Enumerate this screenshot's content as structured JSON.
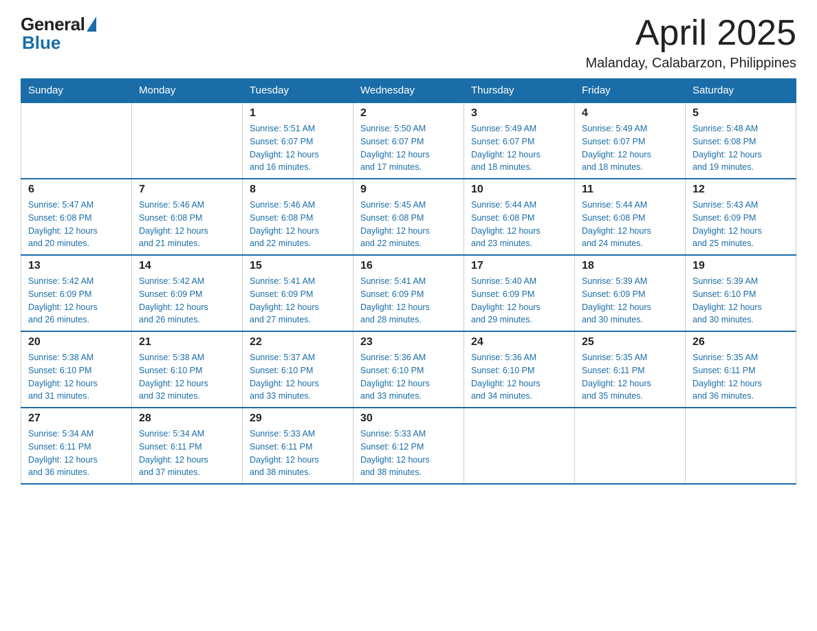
{
  "logo": {
    "general": "General",
    "blue": "Blue"
  },
  "header": {
    "month": "April 2025",
    "location": "Malanday, Calabarzon, Philippines"
  },
  "weekdays": [
    "Sunday",
    "Monday",
    "Tuesday",
    "Wednesday",
    "Thursday",
    "Friday",
    "Saturday"
  ],
  "weeks": [
    [
      {
        "day": "",
        "detail": ""
      },
      {
        "day": "",
        "detail": ""
      },
      {
        "day": "1",
        "detail": "Sunrise: 5:51 AM\nSunset: 6:07 PM\nDaylight: 12 hours\nand 16 minutes."
      },
      {
        "day": "2",
        "detail": "Sunrise: 5:50 AM\nSunset: 6:07 PM\nDaylight: 12 hours\nand 17 minutes."
      },
      {
        "day": "3",
        "detail": "Sunrise: 5:49 AM\nSunset: 6:07 PM\nDaylight: 12 hours\nand 18 minutes."
      },
      {
        "day": "4",
        "detail": "Sunrise: 5:49 AM\nSunset: 6:07 PM\nDaylight: 12 hours\nand 18 minutes."
      },
      {
        "day": "5",
        "detail": "Sunrise: 5:48 AM\nSunset: 6:08 PM\nDaylight: 12 hours\nand 19 minutes."
      }
    ],
    [
      {
        "day": "6",
        "detail": "Sunrise: 5:47 AM\nSunset: 6:08 PM\nDaylight: 12 hours\nand 20 minutes."
      },
      {
        "day": "7",
        "detail": "Sunrise: 5:46 AM\nSunset: 6:08 PM\nDaylight: 12 hours\nand 21 minutes."
      },
      {
        "day": "8",
        "detail": "Sunrise: 5:46 AM\nSunset: 6:08 PM\nDaylight: 12 hours\nand 22 minutes."
      },
      {
        "day": "9",
        "detail": "Sunrise: 5:45 AM\nSunset: 6:08 PM\nDaylight: 12 hours\nand 22 minutes."
      },
      {
        "day": "10",
        "detail": "Sunrise: 5:44 AM\nSunset: 6:08 PM\nDaylight: 12 hours\nand 23 minutes."
      },
      {
        "day": "11",
        "detail": "Sunrise: 5:44 AM\nSunset: 6:08 PM\nDaylight: 12 hours\nand 24 minutes."
      },
      {
        "day": "12",
        "detail": "Sunrise: 5:43 AM\nSunset: 6:09 PM\nDaylight: 12 hours\nand 25 minutes."
      }
    ],
    [
      {
        "day": "13",
        "detail": "Sunrise: 5:42 AM\nSunset: 6:09 PM\nDaylight: 12 hours\nand 26 minutes."
      },
      {
        "day": "14",
        "detail": "Sunrise: 5:42 AM\nSunset: 6:09 PM\nDaylight: 12 hours\nand 26 minutes."
      },
      {
        "day": "15",
        "detail": "Sunrise: 5:41 AM\nSunset: 6:09 PM\nDaylight: 12 hours\nand 27 minutes."
      },
      {
        "day": "16",
        "detail": "Sunrise: 5:41 AM\nSunset: 6:09 PM\nDaylight: 12 hours\nand 28 minutes."
      },
      {
        "day": "17",
        "detail": "Sunrise: 5:40 AM\nSunset: 6:09 PM\nDaylight: 12 hours\nand 29 minutes."
      },
      {
        "day": "18",
        "detail": "Sunrise: 5:39 AM\nSunset: 6:09 PM\nDaylight: 12 hours\nand 30 minutes."
      },
      {
        "day": "19",
        "detail": "Sunrise: 5:39 AM\nSunset: 6:10 PM\nDaylight: 12 hours\nand 30 minutes."
      }
    ],
    [
      {
        "day": "20",
        "detail": "Sunrise: 5:38 AM\nSunset: 6:10 PM\nDaylight: 12 hours\nand 31 minutes."
      },
      {
        "day": "21",
        "detail": "Sunrise: 5:38 AM\nSunset: 6:10 PM\nDaylight: 12 hours\nand 32 minutes."
      },
      {
        "day": "22",
        "detail": "Sunrise: 5:37 AM\nSunset: 6:10 PM\nDaylight: 12 hours\nand 33 minutes."
      },
      {
        "day": "23",
        "detail": "Sunrise: 5:36 AM\nSunset: 6:10 PM\nDaylight: 12 hours\nand 33 minutes."
      },
      {
        "day": "24",
        "detail": "Sunrise: 5:36 AM\nSunset: 6:10 PM\nDaylight: 12 hours\nand 34 minutes."
      },
      {
        "day": "25",
        "detail": "Sunrise: 5:35 AM\nSunset: 6:11 PM\nDaylight: 12 hours\nand 35 minutes."
      },
      {
        "day": "26",
        "detail": "Sunrise: 5:35 AM\nSunset: 6:11 PM\nDaylight: 12 hours\nand 36 minutes."
      }
    ],
    [
      {
        "day": "27",
        "detail": "Sunrise: 5:34 AM\nSunset: 6:11 PM\nDaylight: 12 hours\nand 36 minutes."
      },
      {
        "day": "28",
        "detail": "Sunrise: 5:34 AM\nSunset: 6:11 PM\nDaylight: 12 hours\nand 37 minutes."
      },
      {
        "day": "29",
        "detail": "Sunrise: 5:33 AM\nSunset: 6:11 PM\nDaylight: 12 hours\nand 38 minutes."
      },
      {
        "day": "30",
        "detail": "Sunrise: 5:33 AM\nSunset: 6:12 PM\nDaylight: 12 hours\nand 38 minutes."
      },
      {
        "day": "",
        "detail": ""
      },
      {
        "day": "",
        "detail": ""
      },
      {
        "day": "",
        "detail": ""
      }
    ]
  ]
}
